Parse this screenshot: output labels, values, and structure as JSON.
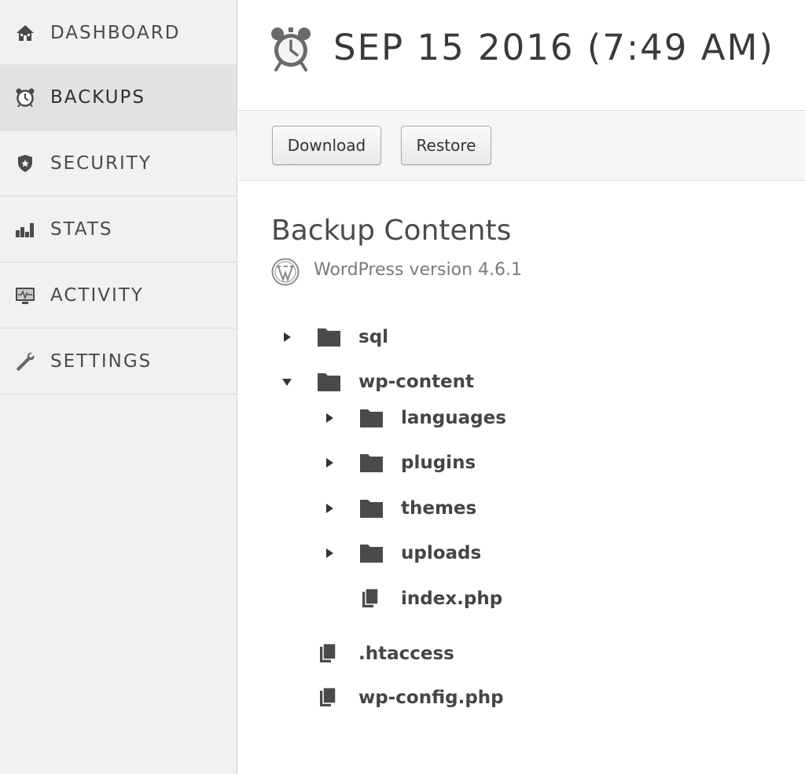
{
  "sidebar": {
    "items": [
      {
        "label": "DASHBOARD",
        "icon": "home-icon",
        "active": false
      },
      {
        "label": "BACKUPS",
        "icon": "alarm-clock-icon",
        "active": true
      },
      {
        "label": "SECURITY",
        "icon": "shield-icon",
        "active": false
      },
      {
        "label": "STATS",
        "icon": "bar-chart-icon",
        "active": false
      },
      {
        "label": "ACTIVITY",
        "icon": "monitor-icon",
        "active": false
      },
      {
        "label": "SETTINGS",
        "icon": "wrench-icon",
        "active": false
      }
    ]
  },
  "header": {
    "title": "SEP 15 2016 (7:49 AM)",
    "icon": "alarm-clock-icon"
  },
  "toolbar": {
    "download_label": "Download",
    "restore_label": "Restore"
  },
  "content": {
    "title": "Backup Contents",
    "wp_version": "WordPress version 4.6.1",
    "wp_icon": "wordpress-icon"
  },
  "tree": [
    {
      "label": "sql",
      "type": "folder",
      "expanded": false
    },
    {
      "label": "wp-content",
      "type": "folder",
      "expanded": true
    },
    {
      "label": "languages",
      "type": "folder",
      "expanded": false
    },
    {
      "label": "plugins",
      "type": "folder",
      "expanded": false
    },
    {
      "label": "themes",
      "type": "folder",
      "expanded": false
    },
    {
      "label": "uploads",
      "type": "folder",
      "expanded": false
    },
    {
      "label": "index.php",
      "type": "file"
    },
    {
      "label": ".htaccess",
      "type": "file"
    },
    {
      "label": "wp-config.php",
      "type": "file"
    }
  ],
  "colors": {
    "sidebar_bg": "#f1f1f2",
    "sidebar_active_bg": "#e2e2e4",
    "text_dark": "#3a3a3c",
    "icon_dark": "#4a4a4c"
  }
}
